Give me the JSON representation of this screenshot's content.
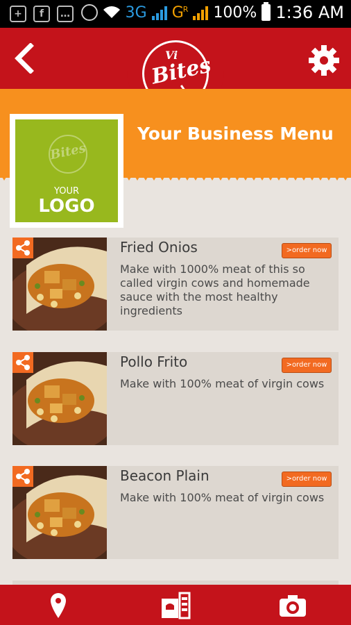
{
  "status_bar": {
    "network": "3G",
    "network2": "G",
    "roaming": "R",
    "battery": "100%",
    "time": "1:36 AM"
  },
  "header": {
    "logo_vi": "Vi",
    "logo_bites": "Bites"
  },
  "banner": {
    "title": "Your Business Menu",
    "logo_watermark": "Bites",
    "logo_your": "YOUR",
    "logo_logo": "LOGO"
  },
  "menu": {
    "items": [
      {
        "title": "Fried Onios",
        "description": "Make with 1000% meat of this so called virgin cows and homemade sauce with the most healthy ingredients",
        "order_label": ">order now"
      },
      {
        "title": "Pollo Frito",
        "description": "Make with 100% meat of virgin cows",
        "order_label": ">order now"
      },
      {
        "title": "Beacon Plain",
        "description": "Make with 100% meat of virgin cows",
        "order_label": ">order now"
      }
    ]
  },
  "bottom_nav": {
    "icons": [
      "location-pin-icon",
      "menu-book-icon",
      "camera-icon"
    ]
  },
  "colors": {
    "header_red": "#c4131b",
    "banner_orange": "#f7901e",
    "accent_orange": "#f26a21",
    "logo_green": "#98b81e"
  }
}
